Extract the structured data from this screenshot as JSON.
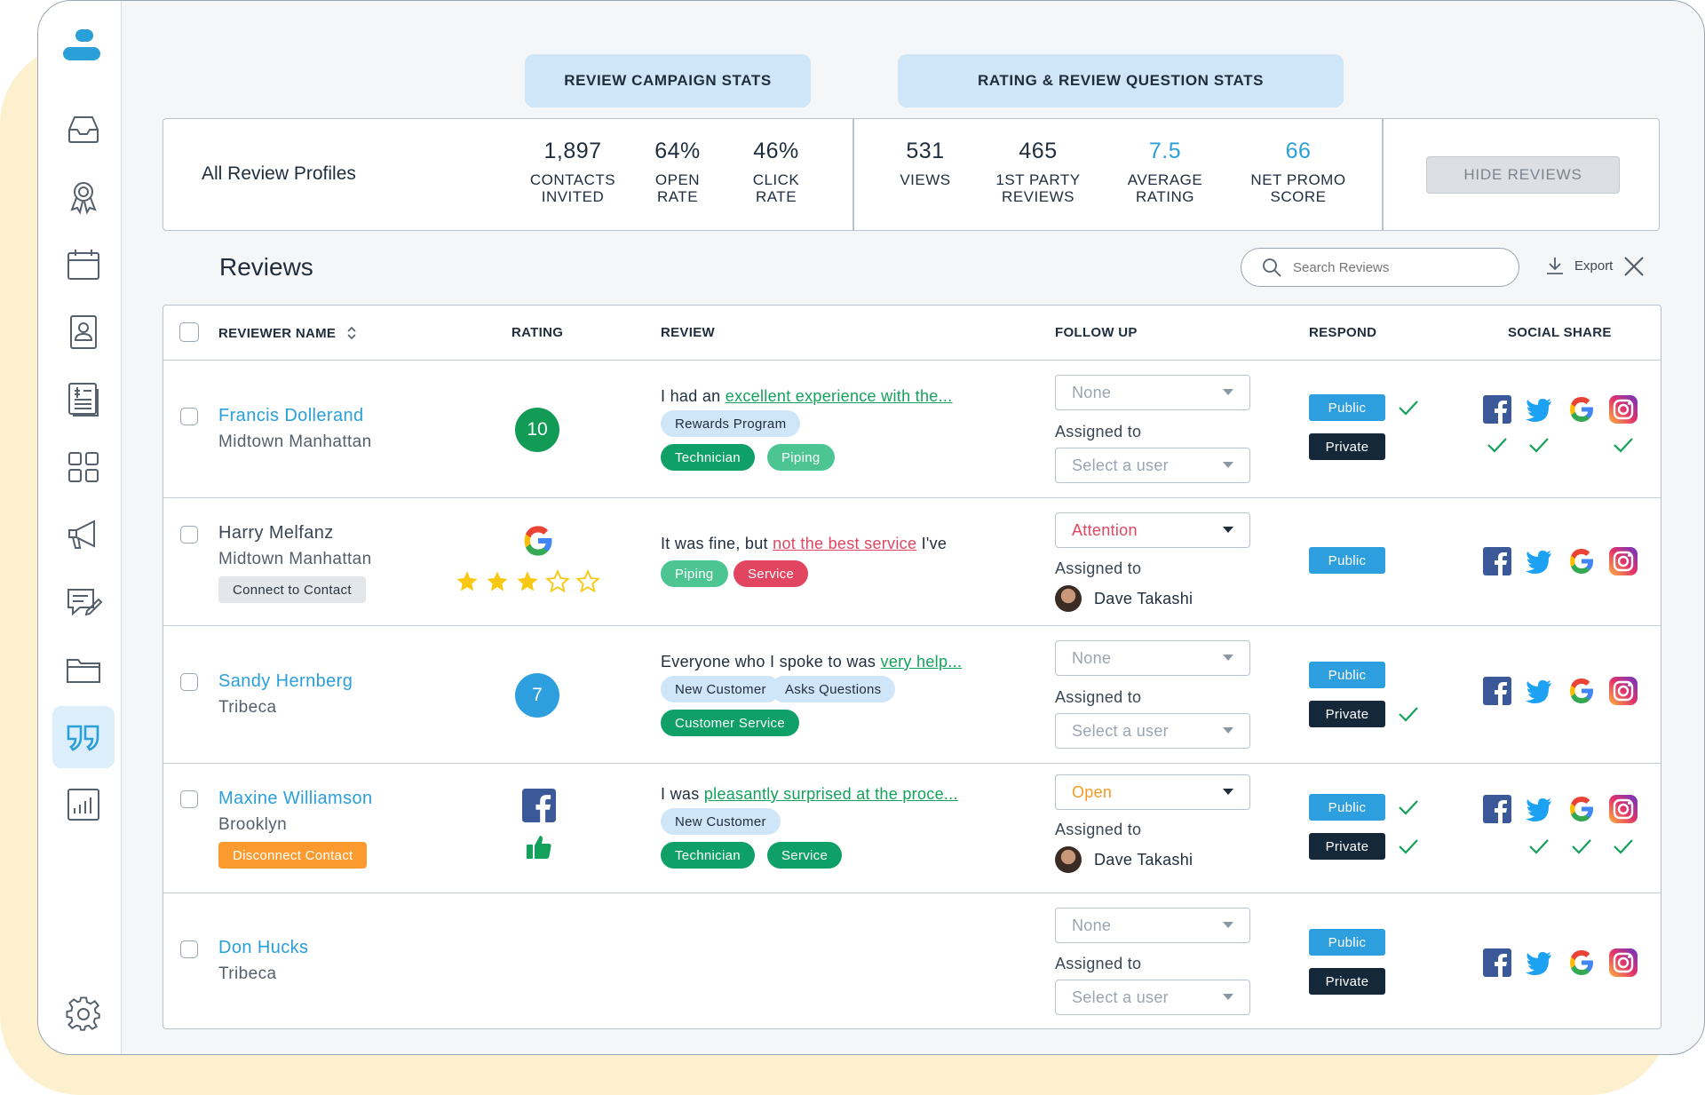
{
  "tabs": {
    "campaign": "REVIEW CAMPAIGN STATS",
    "rating": "RATING & REVIEW QUESTION STATS"
  },
  "stats": {
    "profiles_label": "All Review Profiles",
    "items": [
      {
        "value": "1,897",
        "label1": "CONTACTS",
        "label2": "INVITED"
      },
      {
        "value": "64%",
        "label1": "OPEN",
        "label2": "RATE"
      },
      {
        "value": "46%",
        "label1": "CLICK",
        "label2": "RATE"
      },
      {
        "value": "531",
        "label1": "VIEWS",
        "label2": ""
      },
      {
        "value": "465",
        "label1": "1ST PARTY",
        "label2": "REVIEWS"
      },
      {
        "value": "7.5",
        "label1": "AVERAGE",
        "label2": "RATING"
      },
      {
        "value": "66",
        "label1": "NET PROMO",
        "label2": "SCORE"
      }
    ],
    "hide_button": "HIDE REVIEWS"
  },
  "reviews_header": {
    "title": "Reviews",
    "search_placeholder": "Search Reviews",
    "export_label": "Export"
  },
  "columns": [
    "REVIEWER NAME",
    "RATING",
    "REVIEW",
    "FOLLOW UP",
    "RESPOND",
    "SOCIAL SHARE"
  ],
  "rows": [
    {
      "name": "Francis Dollerand",
      "location": "Midtown Manhattan",
      "rating": "10",
      "review_prefix": "I had an ",
      "review_highlight": "excellent experience with the...",
      "review_suffix": "",
      "tags": [
        "Rewards Program",
        "Technician",
        "Piping"
      ],
      "follow_up": "None",
      "assigned_label": "Assigned to",
      "assigned_value": "Select a user",
      "public": "Public",
      "private": "Private"
    },
    {
      "name": "Harry Melfanz",
      "location": "Midtown Manhattan",
      "contact_button": "Connect to Contact",
      "rating_stars": 3,
      "rating_max": 5,
      "review_prefix": "It was fine, but ",
      "review_highlight": "not the best service",
      "review_suffix": " I've",
      "tags": [
        "Piping",
        "Service"
      ],
      "follow_up": "Attention",
      "assigned_label": "Assigned to",
      "assigned_user": "Dave Takashi",
      "public": "Public"
    },
    {
      "name": "Sandy Hernberg",
      "location": "Tribeca",
      "rating": "7",
      "review_prefix": "Everyone who I spoke to was ",
      "review_highlight": "very help...",
      "review_suffix": "",
      "tags": [
        "New Customer",
        "Asks Questions",
        "Customer Service"
      ],
      "follow_up": "None",
      "assigned_label": "Assigned to",
      "assigned_value": "Select a user",
      "public": "Public",
      "private": "Private"
    },
    {
      "name": "Maxine Williamson",
      "location": "Brooklyn",
      "contact_button": "Disconnect Contact",
      "review_prefix": "I was ",
      "review_highlight": "pleasantly surprised at the proce...",
      "review_suffix": "",
      "tags": [
        "New Customer",
        "Technician",
        "Service"
      ],
      "follow_up": "Open",
      "assigned_label": "Assigned to",
      "assigned_user": "Dave Takashi",
      "public": "Public",
      "private": "Private"
    },
    {
      "name": "Don Hucks",
      "location": "Tribeca",
      "follow_up": "None",
      "assigned_label": "Assigned to",
      "assigned_value": "Select a user",
      "public": "Public",
      "private": "Private"
    }
  ],
  "colors": {
    "accent": "#2a9fd8",
    "green": "#119b55",
    "private": "#14283a",
    "attention": "#e24560",
    "open": "#f59a22"
  }
}
